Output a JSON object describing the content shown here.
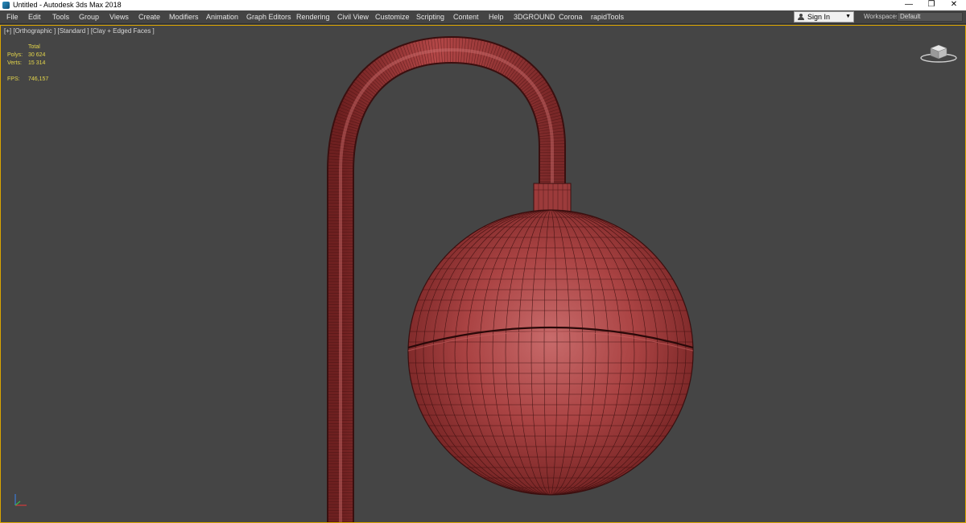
{
  "window": {
    "title": "Untitled - Autodesk 3ds Max 2018",
    "controls": {
      "minimize": "—",
      "maximize": "❐",
      "close": "✕"
    }
  },
  "menubar": {
    "items": [
      "File",
      "Edit",
      "Tools",
      "Group",
      "Views",
      "Create",
      "Modifiers",
      "Animation",
      "Graph Editors",
      "Rendering",
      "Civil View",
      "Customize",
      "Scripting",
      "Content",
      "Help",
      "3DGROUND",
      "Corona",
      "rapidTools"
    ],
    "sign_in": "Sign In",
    "workspaces_label": "Workspaces:",
    "workspaces_value": "Default"
  },
  "viewport": {
    "label": "[+] [Orthographic ] [Standard ] [Clay + Edged Faces ]",
    "stats": {
      "header": "Total",
      "polys_label": "Polys:",
      "polys_value": "30 624",
      "verts_label": "Verts:",
      "verts_value": "15 314",
      "fps_label": "FPS:",
      "fps_value": "746,157"
    },
    "clay_color": "#a33c3c",
    "wire_color": "#3a0f0f",
    "border_color": "#d9a400",
    "background_color": "#454545"
  }
}
